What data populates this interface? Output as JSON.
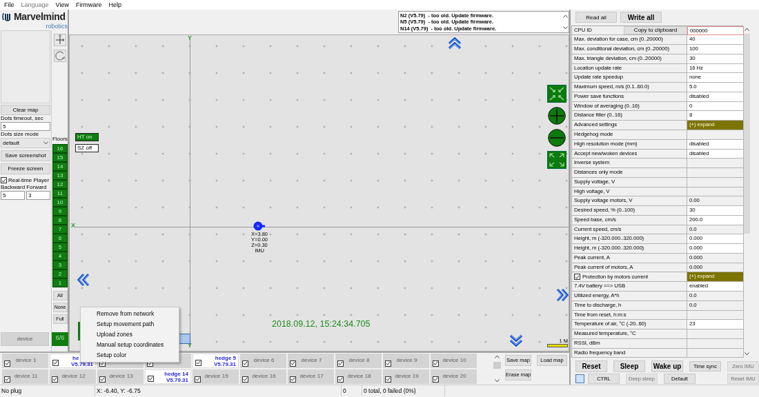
{
  "menu": [
    {
      "label": "File",
      "disabled": false
    },
    {
      "label": "Language",
      "disabled": true
    },
    {
      "label": "View",
      "disabled": false
    },
    {
      "label": "Firmware",
      "disabled": false
    },
    {
      "label": "Help",
      "disabled": false
    }
  ],
  "logo": {
    "name": "Marvelmind",
    "tagline": "robotics"
  },
  "left_panel": {
    "clear_button": "Clear map",
    "dots_timeout": {
      "label": "Dots timeout, sec",
      "value": "5"
    },
    "dots_size": {
      "label": "Dots size mode",
      "value": "default"
    },
    "save_button": "Save screenshot",
    "freeze_button": "Freeze screen",
    "realtime": {
      "label": "Real-time Player",
      "checked": true
    },
    "backward": {
      "label": "Backward",
      "value": "5"
    },
    "forward": {
      "label": "Forward",
      "value": "3"
    },
    "device_button": "device"
  },
  "floors": {
    "title": "Floors",
    "items": [
      {
        "label": "16",
        "on": true
      },
      {
        "label": "15",
        "on": true
      },
      {
        "label": "14",
        "on": true
      },
      {
        "label": "13",
        "on": true
      },
      {
        "label": "12",
        "on": true
      },
      {
        "label": "11",
        "on": true
      },
      {
        "label": "10",
        "on": true
      },
      {
        "label": "9",
        "on": true
      },
      {
        "label": "8",
        "on": true
      },
      {
        "label": "7",
        "on": true
      },
      {
        "label": "6",
        "on": true
      },
      {
        "label": "5",
        "on": true
      },
      {
        "label": "4",
        "on": true
      },
      {
        "label": "3",
        "on": true
      },
      {
        "label": "2",
        "on": true
      },
      {
        "label": "1",
        "on": true
      }
    ],
    "buttons": [
      "All",
      "None",
      "Full"
    ],
    "count": "6/6"
  },
  "messages": [
    "N2 (V5.79)  - too old. Update firmware.",
    "N5 (V5.79)  - too old. Update firmware.",
    "N14 (V5.79)  - too old. Update firmware."
  ],
  "map": {
    "axis_x": "X",
    "axis_y_top": "Y",
    "axis_y_bottom": "Y",
    "toggles": [
      {
        "label": "HT on",
        "on": true
      },
      {
        "label": "SZ off",
        "on": false
      }
    ],
    "device_lines": [
      "X=3.80",
      "Y=0.00",
      "Z=0.30",
      "IMU"
    ],
    "timestamp": "2018.09.12, 15:24:34.705",
    "scale": "1 M"
  },
  "context_menu": [
    "Remove from network",
    "Setup movement path",
    "Upload zones",
    "Manual setup coordinates",
    "Setup color"
  ],
  "devices": [
    [
      {
        "kind": "device",
        "label": "device 1",
        "checked": true
      },
      {
        "kind": "partial",
        "label": "he",
        "version": "V5.79.31",
        "checked": true
      },
      {
        "kind": "covered",
        "checked": true
      },
      {
        "kind": "covered",
        "checked": true
      },
      {
        "kind": "hedge",
        "label": "hedge 5",
        "version": "V5.79.31",
        "checked": true
      },
      {
        "kind": "device",
        "label": "device 6",
        "checked": true
      },
      {
        "kind": "device",
        "label": "device 7",
        "checked": true
      },
      {
        "kind": "device",
        "label": "device 8",
        "checked": true
      },
      {
        "kind": "device",
        "label": "device 9",
        "checked": true
      },
      {
        "kind": "device",
        "label": "device 10",
        "checked": true
      }
    ],
    [
      {
        "kind": "device",
        "label": "device 11",
        "checked": true
      },
      {
        "kind": "device",
        "label": "device 12",
        "checked": true
      },
      {
        "kind": "device",
        "label": "device 13",
        "checked": true
      },
      {
        "kind": "hedge",
        "label": "hedge 14",
        "version": "V5.79.31",
        "checked": true
      },
      {
        "kind": "device",
        "label": "device 15",
        "checked": true
      },
      {
        "kind": "device",
        "label": "device 16",
        "checked": true
      },
      {
        "kind": "device",
        "label": "device 17",
        "checked": true
      },
      {
        "kind": "device",
        "label": "device 18",
        "checked": true
      },
      {
        "kind": "device",
        "label": "device 19",
        "checked": true
      },
      {
        "kind": "device",
        "label": "device 20",
        "checked": true
      }
    ]
  ],
  "map_buttons": [
    "Save map",
    "Load map",
    "Erase map"
  ],
  "properties": {
    "read_button": "Read all",
    "write_button": "Write all",
    "rows": [
      {
        "label": "CPU ID",
        "button": "Copy to clipboard",
        "value": "000000",
        "kind": "focused"
      },
      {
        "label": "Max. deviation for case, cm (0..20000)",
        "value": "40",
        "kind": "edit"
      },
      {
        "label": "Max. conditional deviation, cm (0..20000)",
        "value": "100",
        "kind": "edit"
      },
      {
        "label": "Max. triangle deviation, cm (0..20000)",
        "value": "30",
        "kind": "edit"
      },
      {
        "label": "Location update rate",
        "value": "16 Hz",
        "kind": "edit"
      },
      {
        "label": "Update rate speedup",
        "value": "none",
        "kind": "edit"
      },
      {
        "label": "Maximum speed, m/s (0.1..60.0)",
        "value": "5.0",
        "kind": "edit"
      },
      {
        "label": "Power save functions",
        "value": "disabled",
        "kind": "edit"
      },
      {
        "label": "Window of averaging (0..16)",
        "value": "0",
        "kind": "edit"
      },
      {
        "label": "Distance filter (0..16)",
        "value": "8",
        "kind": "edit"
      },
      {
        "label": "Advanced settings",
        "value": "(+) expand",
        "kind": "expand"
      },
      {
        "label": "Hedgehog mode",
        "kind": "readonly"
      },
      {
        "label": "High resolution mode (mm)",
        "value": "disabled",
        "kind": "edit"
      },
      {
        "label": "Accept new/woken devices",
        "value": "disabled",
        "kind": "edit"
      },
      {
        "label": "Inverse system",
        "kind": "readonly"
      },
      {
        "label": "Distances only mode",
        "kind": "readonly"
      },
      {
        "label": "Supply voltage, V",
        "kind": "readonly"
      },
      {
        "label": "High voltage, V",
        "kind": "readonly"
      },
      {
        "label": "Supply voltage motors, V",
        "value": "0.00",
        "kind": "readonly"
      },
      {
        "label": "Desired speed, % (0..100)",
        "value": "30",
        "kind": "edit"
      },
      {
        "label": "Speed base, cm/s",
        "value": "200.0",
        "kind": "edit"
      },
      {
        "label": "Current speed, cm/s",
        "value": "0.0",
        "kind": "readonly"
      },
      {
        "label": "Height, m (-320.000..320.000)",
        "value": "0.000",
        "kind": "edit"
      },
      {
        "label": "Height, m (-320.000..320.000)",
        "value": "0.000",
        "kind": "edit"
      },
      {
        "label": "Peak current, A",
        "value": "0.000",
        "kind": "readonly"
      },
      {
        "label": "Peak current of motors, A",
        "value": "0.000",
        "kind": "readonly"
      },
      {
        "label": "Protection by motors current",
        "value": "(+) expand",
        "kind": "expand",
        "checked": true
      },
      {
        "label": "7.4V battery ==> USB",
        "value": "enabled",
        "kind": "edit"
      },
      {
        "label": "Utilized energy, A*h",
        "value": "0.0",
        "kind": "readonly"
      },
      {
        "label": "Time to discharge, h",
        "value": "0.0",
        "kind": "readonly"
      },
      {
        "label": "Time from reset, h:m:s",
        "kind": "readonly"
      },
      {
        "label": "Temperature of air, °C (-20..60)",
        "value": "23",
        "kind": "edit"
      },
      {
        "label": "Measured temperature, °C",
        "kind": "readonly"
      },
      {
        "label": "RSSI, dBm",
        "kind": "readonly"
      },
      {
        "label": "Radio frequency band",
        "kind": "readonly"
      }
    ]
  },
  "controls": [
    [
      {
        "kind": "large",
        "label": "Reset",
        "disabled": false
      },
      {
        "kind": "large",
        "label": "Sleep",
        "disabled": false
      },
      {
        "kind": "large",
        "label": "Wake up",
        "disabled": false
      },
      {
        "kind": "small",
        "label": "Time sync",
        "disabled": false
      },
      {
        "kind": "small",
        "label": "Zero IMU",
        "disabled": true
      }
    ],
    [
      {
        "kind": "swatch"
      },
      {
        "kind": "small",
        "label": "CTRL",
        "disabled": false
      },
      {
        "kind": "small",
        "label": "Deep sleep",
        "disabled": true
      },
      {
        "kind": "small",
        "label": "Default",
        "disabled": false
      },
      {
        "kind": "small",
        "label": "Reset IMU",
        "disabled": true
      }
    ]
  ],
  "status_bar": [
    "No plug",
    "X: -6.40, Y: -6.75",
    "0",
    "0 total, 0 failed (0%)"
  ]
}
